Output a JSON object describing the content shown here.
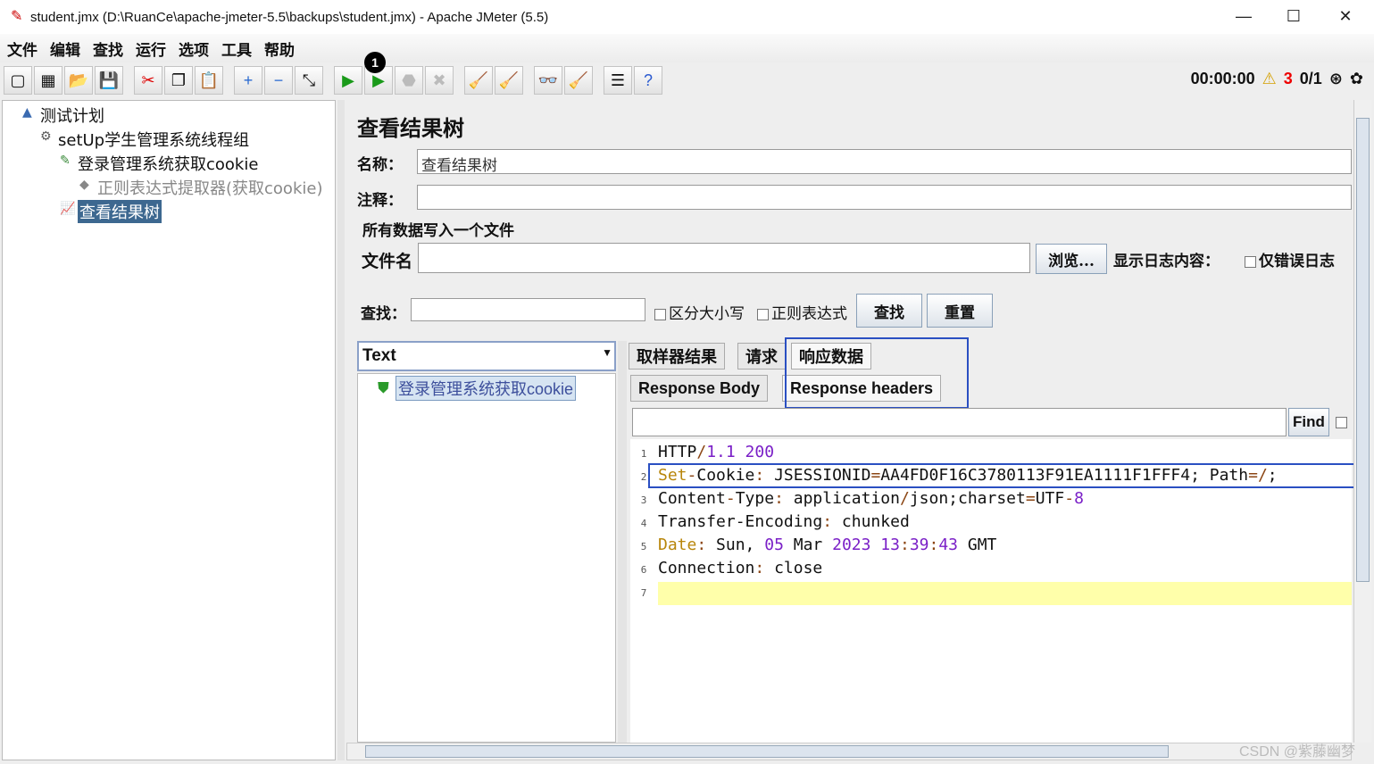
{
  "window": {
    "title": "student.jmx (D:\\RuanCe\\apache-jmeter-5.5\\backups\\student.jmx) - Apache JMeter (5.5)",
    "minimize": "—",
    "maximize": "☐",
    "close": "✕"
  },
  "menu": [
    "文件",
    "编辑",
    "查找",
    "运行",
    "选项",
    "工具",
    "帮助"
  ],
  "toolbar": {
    "icons": [
      "new-icon",
      "templates-icon",
      "open-icon",
      "save-icon",
      "cut-icon",
      "copy-icon",
      "paste-icon",
      "expand-icon",
      "collapse-icon",
      "toggle-icon",
      "start-icon",
      "start-no-pause-icon",
      "stop-icon",
      "shutdown-icon",
      "clear-icon",
      "clear-all-icon",
      "search-icon",
      "reset-search-icon",
      "function-helper-icon",
      "help-icon"
    ],
    "glyphs": [
      "▢",
      "▦",
      "📂",
      "💾",
      "✂",
      "❐",
      "📋",
      "+",
      "−",
      "⤡",
      "▶",
      "▶",
      "⬣",
      "✖",
      "🧹",
      "🧹",
      "👓",
      "🧹",
      "☰",
      "?"
    ],
    "badge": "1"
  },
  "status": {
    "timer": "00:00:00",
    "warnings": "3",
    "threads": "0/1"
  },
  "tree": [
    {
      "label": "测试计划"
    },
    {
      "label": "setUp学生管理系统线程组"
    },
    {
      "label": "登录管理系统获取cookie"
    },
    {
      "label": "正则表达式提取器(获取cookie)"
    },
    {
      "label": "查看结果树"
    }
  ],
  "panel": {
    "title": "查看结果树",
    "name_label": "名称：",
    "name_value": "查看结果树",
    "comment_label": "注释：",
    "comment_value": "",
    "file_section": "所有数据写入一个文件",
    "filename_label": "文件名",
    "filename_value": "",
    "browse": "浏览...",
    "log_label": "显示日志内容：",
    "errors_only": "仅错误日志",
    "search_label": "查找：",
    "search_value": "",
    "case_sensitive": "区分大小写",
    "regex": "正则表达式",
    "find_btn": "查找",
    "reset_btn": "重置"
  },
  "results": {
    "renderer": "Text",
    "items": [
      "登录管理系统获取cookie"
    ],
    "tabs": [
      "取样器结果",
      "请求",
      "响应数据"
    ],
    "subtabs": [
      "Response Body",
      "Response headers"
    ],
    "find": "Find"
  },
  "code": [
    [
      [
        "HTTP",
        "d"
      ],
      [
        "/",
        "p"
      ],
      [
        "1.1 200",
        "n"
      ]
    ],
    [
      [
        "Set",
        "k"
      ],
      [
        "-",
        "p"
      ],
      [
        "Cookie",
        "d"
      ],
      [
        ": ",
        "p"
      ],
      [
        "JSESSIONID",
        "d"
      ],
      [
        "=",
        "p"
      ],
      [
        "AA4FD0F16C3780113F91EA1111F1FFF4; Path",
        "d"
      ],
      [
        "=/",
        "p"
      ],
      [
        ";",
        "d"
      ]
    ],
    [
      [
        "Content",
        "d"
      ],
      [
        "-",
        "p"
      ],
      [
        "Type",
        "d"
      ],
      [
        ": ",
        "p"
      ],
      [
        "application",
        "d"
      ],
      [
        "/",
        "p"
      ],
      [
        "json;charset",
        "d"
      ],
      [
        "=",
        "p"
      ],
      [
        "UTF",
        "d"
      ],
      [
        "-",
        "p"
      ],
      [
        "8",
        "n"
      ]
    ],
    [
      [
        "Transfer-Encoding",
        "d"
      ],
      [
        ": ",
        "p"
      ],
      [
        "chunked",
        "d"
      ]
    ],
    [
      [
        "Date",
        "k"
      ],
      [
        ": ",
        "p"
      ],
      [
        "Sun, ",
        "d"
      ],
      [
        "05",
        "n"
      ],
      [
        " Mar ",
        "d"
      ],
      [
        "2023 13",
        "n"
      ],
      [
        ":",
        "p"
      ],
      [
        "39",
        "n"
      ],
      [
        ":",
        "p"
      ],
      [
        "43",
        "n"
      ],
      [
        " GMT",
        "d"
      ]
    ],
    [
      [
        "Connection",
        "d"
      ],
      [
        ": ",
        "p"
      ],
      [
        "close",
        "d"
      ]
    ],
    []
  ],
  "watermark": "CSDN @紫藤幽梦",
  "colors": {
    "selection": "#3d6890",
    "highlight": "#2a4fc2",
    "current_line": "#ffffaa"
  }
}
